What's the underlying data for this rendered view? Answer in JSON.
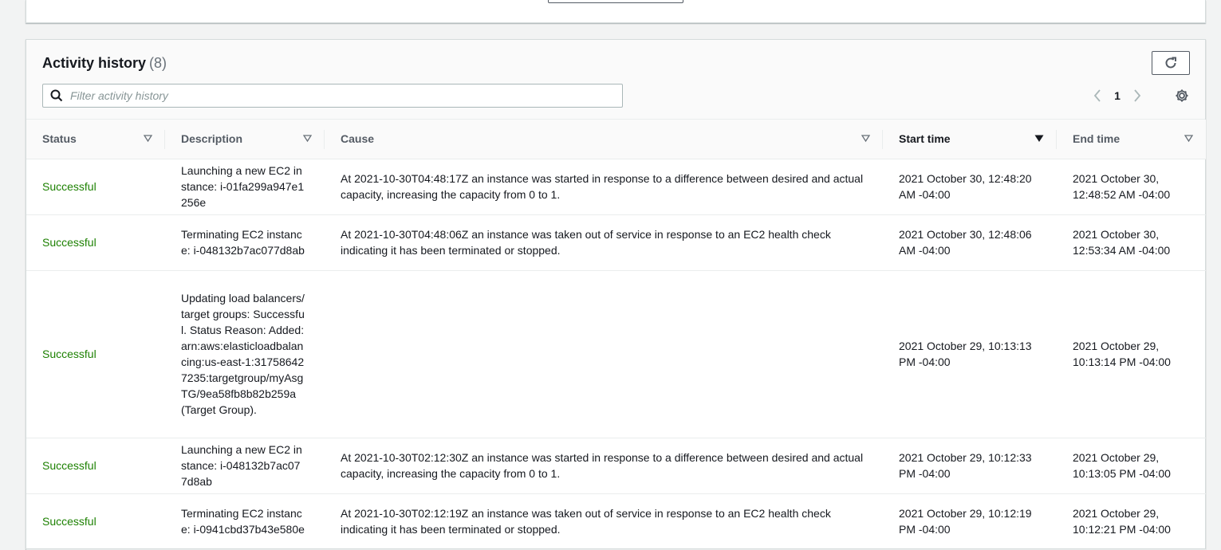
{
  "panel": {
    "title": "Activity history",
    "count": "(8)"
  },
  "filter": {
    "placeholder": "Filter activity history"
  },
  "pagination": {
    "page": "1"
  },
  "table": {
    "columns": [
      "Status",
      "Description",
      "Cause",
      "Start time",
      "End time"
    ],
    "sorted_column": "Start time",
    "rows": [
      {
        "status": "Successful",
        "description": "Launching a new EC2 instance: i-01fa299a947e1256e",
        "cause": "At 2021-10-30T04:48:17Z an instance was started in response to a difference between desired and actual capacity, increasing the capacity from 0 to 1.",
        "start": "2021 October 30, 12:48:20 AM -04:00",
        "end": "2021 October 30, 12:48:52 AM -04:00"
      },
      {
        "status": "Successful",
        "description": "Terminating EC2 instance: i-048132b7ac077d8ab",
        "cause": "At 2021-10-30T04:48:06Z an instance was taken out of service in response to an EC2 health check indicating it has been terminated or stopped.",
        "start": "2021 October 30, 12:48:06 AM -04:00",
        "end": "2021 October 30, 12:53:34 AM -04:00"
      },
      {
        "status": "Successful",
        "description": "Updating load balancers/target groups: Successful. Status Reason: Added: arn:aws:elasticloadbalancing:us-east-1:317586427235:targetgroup/myAsgTG/9ea58fb8b82b259a (Target Group).",
        "cause": "",
        "start": "2021 October 29, 10:13:13 PM -04:00",
        "end": "2021 October 29, 10:13:14 PM -04:00"
      },
      {
        "status": "Successful",
        "description": "Launching a new EC2 instance: i-048132b7ac077d8ab",
        "cause": "At 2021-10-30T02:12:30Z an instance was started in response to a difference between desired and actual capacity, increasing the capacity from 0 to 1.",
        "start": "2021 October 29, 10:12:33 PM -04:00",
        "end": "2021 October 29, 10:13:05 PM -04:00"
      },
      {
        "status": "Successful",
        "description": "Terminating EC2 instance: i-0941cbd37b43e580e",
        "cause": "At 2021-10-30T02:12:19Z an instance was taken out of service in response to an EC2 health check indicating it has been terminated or stopped.",
        "start": "2021 October 29, 10:12:19 PM -04:00",
        "end": "2021 October 29, 10:12:21 PM -04:00"
      }
    ]
  }
}
